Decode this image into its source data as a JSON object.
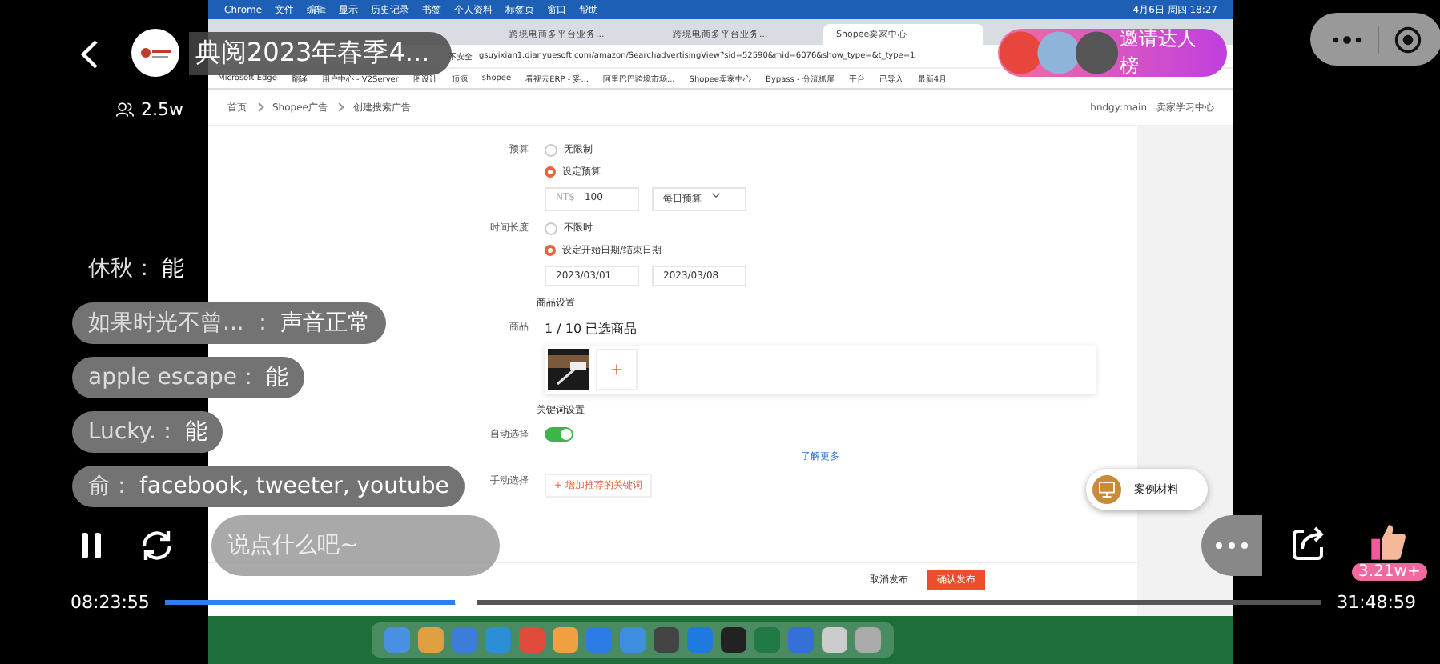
{
  "stream": {
    "title": "典阅2023年春季4...",
    "viewers": "2.5w",
    "invite": "邀请达人榜"
  },
  "mac_menu": {
    "items": [
      "Chrome",
      "文件",
      "编辑",
      "显示",
      "历史记录",
      "书签",
      "个人资料",
      "标签页",
      "窗口",
      "帮助"
    ],
    "clock": "4月6日 周四 18:27"
  },
  "browser": {
    "tabs": [
      {
        "label": "跨境电商多平台业务...",
        "selected": false
      },
      {
        "label": "跨境电商多平台业务...",
        "selected": false
      },
      {
        "label": "Shopee卖家中心",
        "selected": true
      }
    ],
    "url": "gsuyixian1.dianyuesoft.com/amazon/SearchadvertisingView?sid=52590&mid=6076&show_type=&t_type=1",
    "security": "不安全",
    "bookmarks": [
      "Microsoft Edge",
      "翻译",
      "用户中心 - V2Server",
      "图设计",
      "顶源",
      "shopee",
      "看视云ERP - 妥...",
      "阿里巴巴跨境市场...",
      "Shopee卖家中心",
      "Bypass - 分流抓屏",
      "平台",
      "已导入",
      "最新4月"
    ]
  },
  "page": {
    "breadcrumb": [
      "首页",
      "Shopee广告",
      "创建搜索广告"
    ],
    "user": "hndgy:main",
    "learning": "卖家学习中心",
    "budget": {
      "label": "预算",
      "options": [
        {
          "label": "无限制",
          "selected": false
        },
        {
          "label": "设定预算",
          "selected": true
        }
      ],
      "currency": "NT$",
      "amount": "100",
      "period": "每日预算"
    },
    "duration": {
      "label": "时间长度",
      "options": [
        {
          "label": "不限时",
          "selected": false
        },
        {
          "label": "设定开始日期/结束日期",
          "selected": true
        }
      ],
      "start": "2023/03/01",
      "end": "2023/03/08"
    },
    "product_section": "商品设置",
    "product_label": "商品",
    "product_count": "1 / 10 已选商品",
    "keyword_section": "关键词设置",
    "auto_label": "自动选择",
    "auto_on": true,
    "learn_more": "了解更多",
    "manual_label": "手动选择",
    "add_keywords": "+ 增加推荐的关键词",
    "cancel": "取消发布",
    "confirm": "确认发布"
  },
  "side_card": "案例材料",
  "chat": [
    {
      "user": "休秋：",
      "text": "能",
      "bubble": false
    },
    {
      "user": "如果时光不曾...  ：",
      "text": "声音正常",
      "bubble": true
    },
    {
      "user": "apple escape：",
      "text": "能",
      "bubble": true
    },
    {
      "user": "Lucky.：",
      "text": "能",
      "bubble": true
    },
    {
      "user": "俞：",
      "text": "facebook, tweeter, youtube",
      "bubble": true
    }
  ],
  "comment": {
    "placeholder": "说点什么吧~"
  },
  "player": {
    "elapsed": "08:23:55",
    "total": "31:48:59",
    "level": 0.26,
    "playing": true
  },
  "likes": "3.21w+"
}
